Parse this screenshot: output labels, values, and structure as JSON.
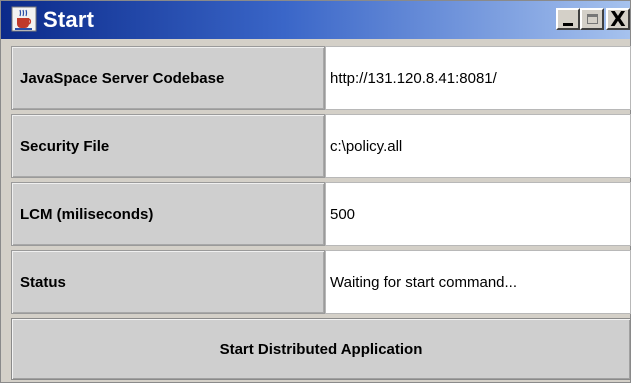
{
  "window": {
    "title": "Start",
    "icon": "java-cup-icon",
    "controls": {
      "minimize": "minimize-icon",
      "maximize": "maximize-icon",
      "close_glyph": "X"
    }
  },
  "fields": [
    {
      "label": "JavaSpace Server Codebase",
      "value": "http://131.120.8.41:8081/"
    },
    {
      "label": "Security File",
      "value": "c:\\policy.all"
    },
    {
      "label": "LCM (miliseconds)",
      "value": "500"
    },
    {
      "label": "Status",
      "value": "Waiting for start command..."
    }
  ],
  "start_button": {
    "label": "Start Distributed Application"
  },
  "colors": {
    "titlebar_start": "#0b2a8a",
    "titlebar_end": "#a6c2ee",
    "panel": "#d4d0c8",
    "label_bg": "#cfcfcf",
    "field_bg": "#ffffff"
  }
}
